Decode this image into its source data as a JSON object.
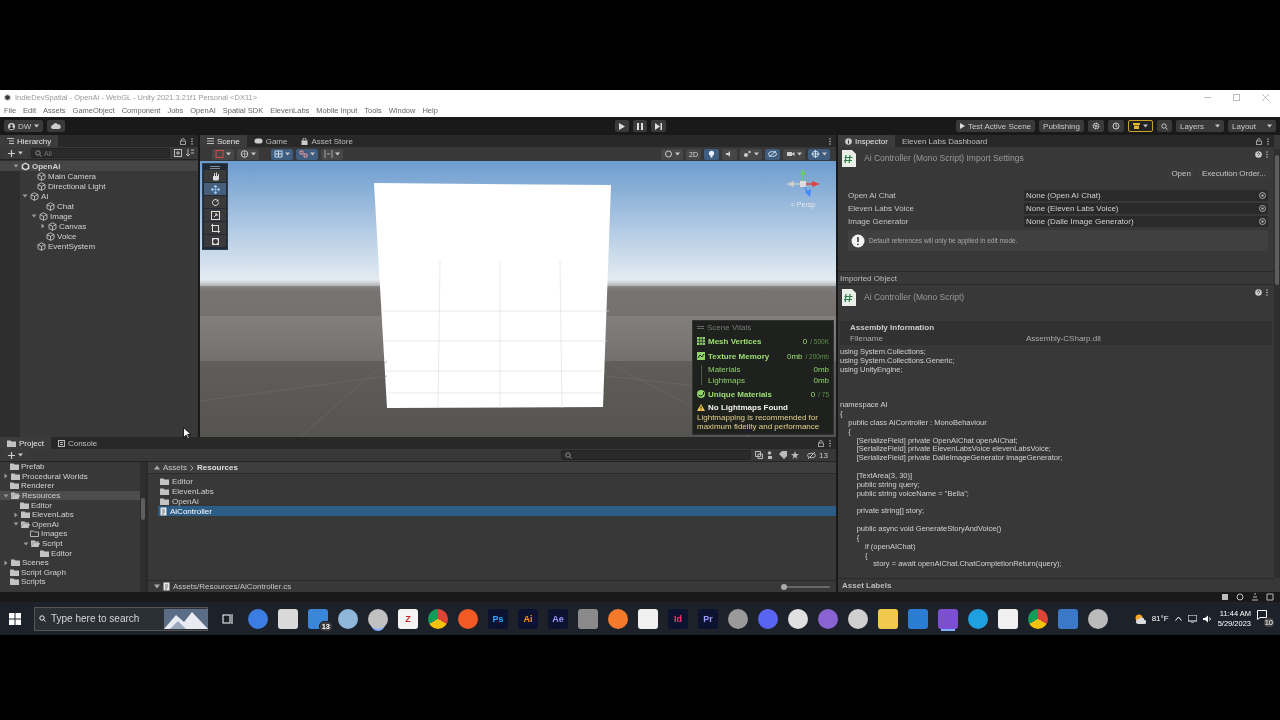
{
  "window": {
    "title": "IndieDevSpatial - OpenAi - WebGL - Unity 2021.3.21f1 Personal <DX11>"
  },
  "menu": [
    "File",
    "Edit",
    "Assets",
    "GameObject",
    "Component",
    "Jobs",
    "OpenAI",
    "Spatial SDK",
    "ElevenLabs",
    "Mobile Input",
    "Tools",
    "Window",
    "Help"
  ],
  "toolbar": {
    "account": "DW",
    "test_button": "Test Active Scene",
    "publishing": "Publishing",
    "layers": "Layers",
    "layout": "Layout"
  },
  "hierarchy": {
    "tab": "Hierarchy",
    "search_placeholder": "All",
    "tree": [
      {
        "label": "OpenAi",
        "kind": "scene",
        "expanded": true,
        "children": [
          {
            "label": "Main Camera",
            "kind": "object"
          },
          {
            "label": "Directional Light",
            "kind": "object"
          },
          {
            "label": "AI",
            "kind": "object",
            "expanded": true,
            "children": [
              {
                "label": "Chat",
                "kind": "object"
              },
              {
                "label": "Image",
                "kind": "object",
                "expanded": true,
                "children": [
                  {
                    "label": "Canvas",
                    "kind": "object",
                    "expanded": false
                  }
                ]
              },
              {
                "label": "Voice",
                "kind": "object"
              }
            ]
          },
          {
            "label": "EventSystem",
            "kind": "object"
          }
        ]
      }
    ]
  },
  "scene_view": {
    "tabs": [
      {
        "label": "Scene",
        "kind": "scene",
        "selected": true
      },
      {
        "label": "Game",
        "kind": "game",
        "selected": false
      },
      {
        "label": "Asset Store",
        "kind": "store",
        "selected": false
      }
    ],
    "mode_2d": "2D",
    "projection": "< Persp",
    "vitals": {
      "title": "Scene Vitals",
      "metrics": [
        {
          "label": "Mesh Vertices",
          "value": "0",
          "limit": "/ 500K",
          "kind": "grid"
        },
        {
          "label": "Texture Memory",
          "value": "0mb",
          "limit": "/ 200mb",
          "kind": "texture",
          "details": [
            {
              "label": "Materials",
              "value": "0mb"
            },
            {
              "label": "Lightmaps",
              "value": "0mb"
            }
          ]
        },
        {
          "label": "Unique Materials",
          "value": "0",
          "limit": "/ 75",
          "kind": "sphere"
        }
      ],
      "warning": {
        "title": "No Lightmaps Found",
        "text": "Lightmapping is recommended for maximum fidelity and performance"
      }
    }
  },
  "inspector": {
    "tabs": [
      {
        "label": "Inspector",
        "selected": true
      },
      {
        "label": "Eleven Labs Dashboard",
        "selected": false
      }
    ],
    "title": "Ai Controller (Mono Script) Import Settings",
    "buttons": [
      "Open",
      "Execution Order..."
    ],
    "fields": [
      {
        "label": "Open Ai Chat",
        "value": "None (Open AI Chat)"
      },
      {
        "label": "Eleven Labs Voice",
        "value": "None (Eleven Labs Voice)"
      },
      {
        "label": "Image Generator",
        "value": "None (Dalle Image Generator)"
      }
    ],
    "info": "Default references will only be applied in edit mode.",
    "imported_heading": "Imported Object",
    "object_title": "Ai Controller (Mono Script)",
    "assembly": {
      "heading": "Assembly Information",
      "label": "Filename",
      "value": "Assembly-CSharp.dll"
    },
    "code": [
      [
        "using System.Collections;",
        "using System.Collections.Generic;",
        "using UnityEngine;"
      ],
      [
        "namespace AI",
        "{",
        "    public class AiController : MonoBehaviour",
        "    {",
        "        [SerializeField] private OpenAIChat openAIChat;",
        "        [SerializeField] private ElevenLabsVoice elevenLabsVoice;",
        "        [SerializeField] private DalleImageGenerator imageGenerator;"
      ],
      [
        "        [TextArea(3, 30)]",
        "        public string query;",
        "        public string voiceName = \"Bella\";"
      ],
      [
        "        private string[] story;"
      ],
      [
        "        public async void GenerateStoryAndVoice()",
        "        {",
        "            if (openAIChat)",
        "            {",
        "                story = await openAIChat.ChatCompletionReturn(query);"
      ]
    ],
    "labels_heading": "Asset Labels"
  },
  "project": {
    "tabs": [
      {
        "label": "Project",
        "selected": true
      },
      {
        "label": "Console",
        "selected": false
      }
    ],
    "hidden_count": "13",
    "tree": [
      {
        "label": "Prefab",
        "kind": "folder",
        "selected": false
      },
      {
        "label": "Procedural Worlds",
        "kind": "folder",
        "selected": false,
        "expanded": false
      },
      {
        "label": "Renderer",
        "kind": "folder",
        "selected": false
      },
      {
        "label": "Resources",
        "kind": "folder",
        "selected": true,
        "expanded": true,
        "children": [
          {
            "label": "Editor",
            "kind": "folder",
            "selected": false
          },
          {
            "label": "ElevenLabs",
            "kind": "folder",
            "selected": false,
            "expanded": false
          },
          {
            "label": "OpenAi",
            "kind": "folder",
            "selected": false,
            "expanded": true,
            "children": [
              {
                "label": "Images",
                "kind": "empty_folder",
                "selected": false
              },
              {
                "label": "Script",
                "kind": "folder",
                "selected": false,
                "expanded": true,
                "children": [
                  {
                    "label": "Editor",
                    "kind": "folder",
                    "selected": false
                  }
                ]
              }
            ]
          }
        ]
      },
      {
        "label": "Scenes",
        "kind": "folder",
        "selected": false,
        "expanded": false
      },
      {
        "label": "Script Graph",
        "kind": "folder",
        "selected": false
      },
      {
        "label": "Scripts",
        "kind": "folder",
        "selected": false
      }
    ],
    "breadcrumb": [
      "Assets",
      "Resources"
    ],
    "items": [
      {
        "label": "Editor",
        "kind": "folder",
        "selected": false
      },
      {
        "label": "ElevenLabs",
        "kind": "folder",
        "selected": false
      },
      {
        "label": "OpenAi",
        "kind": "folder",
        "selected": false
      },
      {
        "label": "AiController",
        "kind": "script",
        "selected": true
      }
    ],
    "path": "Assets/Resources/AiController.cs",
    "zoom_slider": {
      "level": 0
    }
  },
  "taskbar": {
    "search_placeholder": "Type here to search",
    "apps": [
      {
        "kind": "taskview",
        "active": false
      },
      {
        "kind": "circle",
        "color": "#3b7de0",
        "active": false
      },
      {
        "kind": "square",
        "color": "#d9d9d9",
        "active": false
      },
      {
        "kind": "square",
        "color": "#3a86d9",
        "badge": "13",
        "active": false
      },
      {
        "kind": "circle",
        "color": "#8fb6d9",
        "active": false
      },
      {
        "kind": "circle",
        "color": "#c0c0c0",
        "active": true
      },
      {
        "kind": "letters_light",
        "label": "Z",
        "color": "#d8282f",
        "active": false
      },
      {
        "kind": "chrome",
        "active": false
      },
      {
        "kind": "circle",
        "color": "#f25a25",
        "active": false
      },
      {
        "kind": "letters",
        "label": "Ps",
        "color": "#31a8ff",
        "active": false
      },
      {
        "kind": "letters",
        "label": "Ai",
        "color": "#ff9a00",
        "active": false
      },
      {
        "kind": "letters",
        "label": "Ae",
        "color": "#9999ff",
        "active": false
      },
      {
        "kind": "square",
        "color": "#8a8a8a",
        "active": false
      },
      {
        "kind": "circle",
        "color": "#f5792a",
        "active": false
      },
      {
        "kind": "square",
        "color": "#f0f0f0",
        "active": false
      },
      {
        "kind": "letters",
        "label": "Id",
        "color": "#ff3366",
        "active": false
      },
      {
        "kind": "letters",
        "label": "Pr",
        "color": "#9999ff",
        "active": false
      },
      {
        "kind": "circle",
        "color": "#9a9a9a",
        "active": false
      },
      {
        "kind": "circle",
        "color": "#5865f2",
        "active": false
      },
      {
        "kind": "circle",
        "color": "#e0e0e0",
        "active": false
      },
      {
        "kind": "circle",
        "color": "#8a63d2",
        "active": false
      },
      {
        "kind": "circle",
        "color": "#cfcfcf",
        "active": false
      },
      {
        "kind": "square",
        "color": "#f2c94c",
        "active": false
      },
      {
        "kind": "square",
        "color": "#2b7cd3",
        "active": false
      },
      {
        "kind": "square",
        "color": "#7b4fd0",
        "active": true
      },
      {
        "kind": "circle",
        "color": "#1fa0e0",
        "active": false
      },
      {
        "kind": "square",
        "color": "#f0f0f0",
        "active": false
      },
      {
        "kind": "chrome",
        "active": false
      },
      {
        "kind": "square",
        "color": "#3c78c8",
        "active": false
      },
      {
        "kind": "circle",
        "color": "#bbbbbb",
        "active": false
      }
    ],
    "temperature": "81°F",
    "time": "11:44 AM",
    "date": "5/29/2023",
    "notifications": "10"
  }
}
